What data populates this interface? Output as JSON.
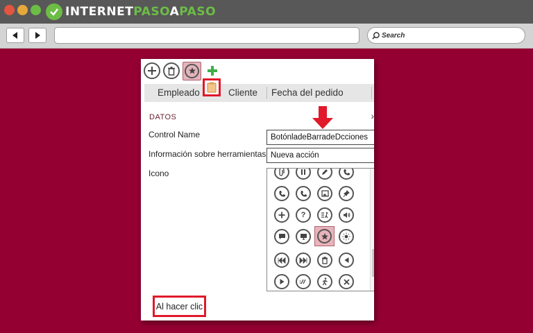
{
  "browser": {
    "logo_brand_1": "INTERNET",
    "logo_brand_2": "PASO",
    "logo_brand_3": "A",
    "logo_brand_4": "PASO",
    "search_placeholder": "Search",
    "colors": {
      "titlebar": "#585858",
      "page_bg": "#950033",
      "brand_green": "#6cbd46"
    }
  },
  "panel": {
    "tabs": [
      "Empleado",
      "Cliente",
      "Fecha del pedido"
    ],
    "section_title": "DATOS",
    "control_name_label": "Control Name",
    "control_name_value": "BotónladeBarradeDcciones",
    "tooltip_label": "Información sobre herramientas",
    "tooltip_value": "Nueva acción",
    "icon_label": "Icono",
    "on_click_label": "Al hacer clic",
    "toolbar_icons": [
      "add-icon",
      "delete-icon",
      "star-icon",
      "green-plus-icon"
    ],
    "icon_grid": [
      [
        "paperclip-icon",
        "pause-icon",
        "pencil-icon",
        "phone-icon"
      ],
      [
        "phone-refresh-icon",
        "phone-check-icon",
        "picture-icon",
        "pin-icon"
      ],
      [
        "plus-icon",
        "question-icon",
        "run-list-icon",
        "volume-icon"
      ],
      [
        "chat-icon",
        "monitor-icon",
        "star-icon",
        "sun-icon"
      ],
      [
        "rewind-icon",
        "fast-forward-icon",
        "trash-icon",
        "back-icon"
      ],
      [
        "play-icon",
        "link-icon",
        "walk-icon",
        "close-icon"
      ]
    ],
    "selected_icon": "star-icon",
    "highlight_color": "#e0192b"
  }
}
